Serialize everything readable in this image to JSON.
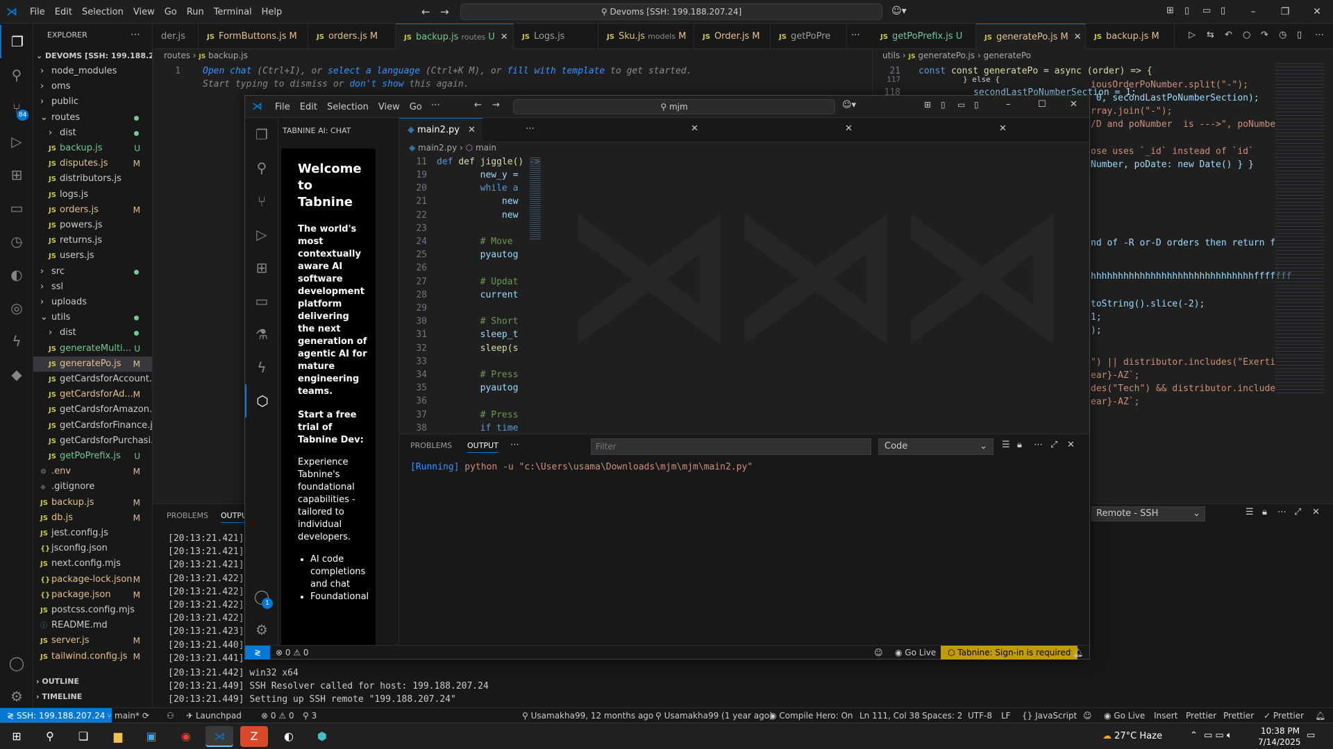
{
  "titlebar": {
    "menus": [
      "File",
      "Edit",
      "Selection",
      "View",
      "Go",
      "Run",
      "Terminal",
      "Help"
    ],
    "search": "Devoms [SSH: 199.188.207.24]"
  },
  "explorer": {
    "header": "EXPLORER",
    "root": "DEVOMS [SSH: 199.188.20...",
    "items": [
      {
        "label": "node_modules",
        "type": "folder",
        "indent": 1,
        "status": ""
      },
      {
        "label": "oms",
        "type": "folder",
        "indent": 1,
        "status": ""
      },
      {
        "label": "public",
        "type": "folder",
        "indent": 1,
        "status": ""
      },
      {
        "label": "routes",
        "type": "folder-open",
        "indent": 1,
        "status": "dot"
      },
      {
        "label": "dist",
        "type": "folder",
        "indent": 2,
        "status": "dot"
      },
      {
        "label": "backup.js",
        "type": "js",
        "indent": 2,
        "status": "U"
      },
      {
        "label": "disputes.js",
        "type": "js",
        "indent": 2,
        "status": "M"
      },
      {
        "label": "distributors.js",
        "type": "js",
        "indent": 2,
        "status": ""
      },
      {
        "label": "logs.js",
        "type": "js",
        "indent": 2,
        "status": ""
      },
      {
        "label": "orders.js",
        "type": "js",
        "indent": 2,
        "status": "M"
      },
      {
        "label": "powers.js",
        "type": "js",
        "indent": 2,
        "status": ""
      },
      {
        "label": "returns.js",
        "type": "js",
        "indent": 2,
        "status": ""
      },
      {
        "label": "users.js",
        "type": "js",
        "indent": 2,
        "status": ""
      },
      {
        "label": "src",
        "type": "folder",
        "indent": 1,
        "status": "dot"
      },
      {
        "label": "ssl",
        "type": "folder",
        "indent": 1,
        "status": ""
      },
      {
        "label": "uploads",
        "type": "folder",
        "indent": 1,
        "status": ""
      },
      {
        "label": "utils",
        "type": "folder-open",
        "indent": 1,
        "status": "dot"
      },
      {
        "label": "dist",
        "type": "folder",
        "indent": 2,
        "status": "dot"
      },
      {
        "label": "generateMulti...",
        "type": "js",
        "indent": 2,
        "status": "U"
      },
      {
        "label": "generatePo.js",
        "type": "js",
        "indent": 2,
        "status": "M",
        "selected": true
      },
      {
        "label": "getCardsforAccount.js",
        "type": "js",
        "indent": 2,
        "status": ""
      },
      {
        "label": "getCardsforAd...",
        "type": "js",
        "indent": 2,
        "status": "M"
      },
      {
        "label": "getCardsforAmazon.js",
        "type": "js",
        "indent": 2,
        "status": ""
      },
      {
        "label": "getCardsforFinance.js",
        "type": "js",
        "indent": 2,
        "status": ""
      },
      {
        "label": "getCardsforPurchasi...",
        "type": "js",
        "indent": 2,
        "status": ""
      },
      {
        "label": "getPoPrefix.js",
        "type": "js",
        "indent": 2,
        "status": "U"
      },
      {
        "label": ".env",
        "type": "gear",
        "indent": 1,
        "status": "M"
      },
      {
        "label": ".gitignore",
        "type": "git",
        "indent": 1,
        "status": ""
      },
      {
        "label": "backup.js",
        "type": "js",
        "indent": 1,
        "status": "M"
      },
      {
        "label": "db.js",
        "type": "js",
        "indent": 1,
        "status": "M"
      },
      {
        "label": "jest.config.js",
        "type": "js",
        "indent": 1,
        "status": ""
      },
      {
        "label": "jsconfig.json",
        "type": "json",
        "indent": 1,
        "status": ""
      },
      {
        "label": "next.config.mjs",
        "type": "js",
        "indent": 1,
        "status": ""
      },
      {
        "label": "package-lock.json",
        "type": "json",
        "indent": 1,
        "status": "M"
      },
      {
        "label": "package.json",
        "type": "json",
        "indent": 1,
        "status": "M"
      },
      {
        "label": "postcss.config.mjs",
        "type": "js",
        "indent": 1,
        "status": ""
      },
      {
        "label": "README.md",
        "type": "info",
        "indent": 1,
        "status": ""
      },
      {
        "label": "server.js",
        "type": "js",
        "indent": 1,
        "status": "M"
      },
      {
        "label": "tailwind.config.js",
        "type": "js",
        "indent": 1,
        "status": "M"
      }
    ],
    "outline": "OUTLINE",
    "timeline": "TIMELINE"
  },
  "tabs": [
    {
      "label": "der.js",
      "status": ""
    },
    {
      "label": "FormButtons.js",
      "status": "M"
    },
    {
      "label": "orders.js",
      "status": "M"
    },
    {
      "label": "backup.js",
      "desc": "routes",
      "status": "U",
      "active": true
    },
    {
      "label": "Logs.js",
      "status": ""
    },
    {
      "label": "Sku.js",
      "desc": "models",
      "status": "M"
    },
    {
      "label": "Order.js",
      "status": "M"
    },
    {
      "label": "getPoPre",
      "status": ""
    }
  ],
  "right_tabs": [
    {
      "label": "getPoPrefix.js",
      "status": "U"
    },
    {
      "label": "generatePo.js",
      "status": "M",
      "active": true
    },
    {
      "label": "backup.js",
      "status": "M"
    }
  ],
  "left_editor": {
    "breadcrumb": [
      "routes",
      "backup.js"
    ],
    "line_number": "1",
    "hint_parts": [
      "Open chat",
      "(Ctrl+I), or",
      "select a language",
      "(Ctrl+K M), or",
      "fill with template",
      "to get started."
    ],
    "hint_line2": [
      "Start typing to dismiss or",
      "don't show",
      "this again."
    ]
  },
  "right_editor": {
    "breadcrumb": [
      "utils",
      "generatePo.js",
      "generatePo"
    ],
    "line21": "21",
    "line21_code": "const generatePo = async (order) => {",
    "line117": "117",
    "line118": "118",
    "line117_code": "} else {",
    "line118_code": "secondLastPoNumberSection = 1;",
    "fragments": [
      "iousOrderPoNumber.split(\"-\");",
      " 0, secondLastPoNumberSection);",
      "rray.join(\"-\");",
      "/D and poNumber  is --->\", poNumbe",
      "ose uses `_id` instead of `id`",
      "Number, poDate: new Date() } }",
      "nd of -R or-D orders then return f",
      "hhhhhhhhhhhhhhhhhhhhhhhhhhhhhhfffffff",
      "toString().slice(-2);",
      "1;",
      ");",
      "\") || distributor.includes(\"Exerti",
      "ear}-AZ`;",
      "des(\"Tech\") && distributor.include",
      "ear}-AZ`;"
    ]
  },
  "bottom_panel": {
    "tabs": [
      "PROBLEMS",
      "OUTPU"
    ],
    "lines": [
      "[20:13:21.421]",
      "[20:13:21.421]",
      "[20:13:21.421]",
      "[20:13:21.422]",
      "[20:13:21.422]",
      "[20:13:21.422]",
      "[20:13:21.422]",
      "[20:13:21.423]",
      "[20:13:21.440]",
      "[20:13:21.441]"
    ],
    "line_full_1": "[20:13:21.442] win32 x64",
    "line_full_2": "[20:13:21.449] SSH Resolver called for host: 199.188.207.24",
    "line_full_3": "[20:13:21.449] Setting up SSH remote \"199.188.207.24\"",
    "channel": "Remote - SSH"
  },
  "inner": {
    "menus": [
      "File",
      "Edit",
      "Selection",
      "View",
      "Go"
    ],
    "search": "mjm",
    "tabnine": {
      "header": "TABNINE AI: CHAT",
      "title": "Welcome to Tabnine",
      "desc": "The world's most contextually aware AI software development platform delivering the next generation of agentic AI for mature engineering teams.",
      "trial_title": "Start a free trial of Tabnine Dev:",
      "trial_desc": "Experience Tabnine's foundational capabilities - tailored to individual developers.",
      "bullets": [
        "AI code completions and chat",
        "Foundational"
      ]
    },
    "tab": "main2.py",
    "breadcrumb": [
      "main2.py",
      "main"
    ],
    "sticky_ln": "11",
    "sticky": "def jiggle() ->",
    "code": [
      {
        "ln": "19",
        "code": "        new_y =",
        "cls": "var"
      },
      {
        "ln": "20",
        "code": "        while a",
        "cls": "kw"
      },
      {
        "ln": "21",
        "code": "            new",
        "cls": "var"
      },
      {
        "ln": "22",
        "code": "            new",
        "cls": "var"
      },
      {
        "ln": "23",
        "code": "",
        "cls": "pu"
      },
      {
        "ln": "24",
        "code": "        # Move",
        "cls": "cm"
      },
      {
        "ln": "25",
        "code": "        pyautog",
        "cls": "var"
      },
      {
        "ln": "26",
        "code": "",
        "cls": "pu"
      },
      {
        "ln": "27",
        "code": "        # Updat",
        "cls": "cm"
      },
      {
        "ln": "28",
        "code": "        current",
        "cls": "var"
      },
      {
        "ln": "29",
        "code": "",
        "cls": "pu"
      },
      {
        "ln": "30",
        "code": "        # Short",
        "cls": "cm"
      },
      {
        "ln": "31",
        "code": "        sleep_t",
        "cls": "var"
      },
      {
        "ln": "32",
        "code": "        sleep(s",
        "cls": "fn"
      },
      {
        "ln": "33",
        "code": "",
        "cls": "pu"
      },
      {
        "ln": "34",
        "code": "        # Press",
        "cls": "cm"
      },
      {
        "ln": "35",
        "code": "        pyautog",
        "cls": "var"
      },
      {
        "ln": "36",
        "code": "",
        "cls": "pu"
      },
      {
        "ln": "37",
        "code": "        # Press",
        "cls": "cm"
      },
      {
        "ln": "38",
        "code": "        if time",
        "cls": "kw"
      }
    ],
    "panel_tabs": [
      "PROBLEMS",
      "OUTPUT"
    ],
    "filter_placeholder": "Filter",
    "channel": "Code",
    "running_tag": "[Running]",
    "running_cmd": "python -u \"c:\\Users\\usama\\Downloads\\mjm\\mjm\\main2.py\"",
    "status": {
      "errors": "0",
      "warnings": "0",
      "golive": "Go Live",
      "tabnine": "Tabnine: Sign-in is required"
    }
  },
  "statusbar": {
    "remote": "SSH: 199.188.207.24",
    "branch": "main*",
    "errors": "0",
    "warnings": "0",
    "ports": "3",
    "blame1": "Usamakha99, 12 months ago",
    "blame2": "Usamakha99 (1 year ago)",
    "hero": "Compile Hero: On",
    "position": "Ln 111, Col 38",
    "spaces": "Spaces: 2",
    "encoding": "UTF-8",
    "eol": "LF",
    "language": "JavaScript",
    "golive": "Go Live",
    "insert": "Insert",
    "prettier1": "Prettier",
    "prettier2": "Prettier",
    "prettier3": "Prettier"
  },
  "taskbar": {
    "weather": "27°C  Haze",
    "time": "10:38 PM",
    "date": "7/14/2025"
  }
}
